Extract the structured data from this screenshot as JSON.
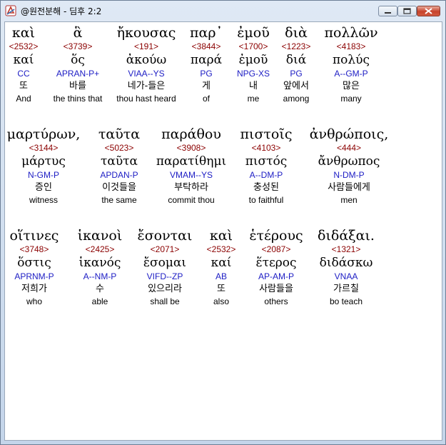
{
  "window": {
    "title": "@원전분해 - 딤후 2:2"
  },
  "rows": [
    {
      "words": [
        {
          "greek": "καὶ",
          "strong": "<2532>",
          "lemma": "καί",
          "morph": "CC",
          "korean": "또",
          "english": "And"
        },
        {
          "greek": "ἃ",
          "strong": "<3739>",
          "lemma": "ὅς",
          "morph": "APRAN-P+",
          "korean": "바를",
          "english": "the thins that"
        },
        {
          "greek": "ἤκουσας",
          "strong": "<191>",
          "lemma": "ἀκούω",
          "morph": "VIAA--YS",
          "korean": "네가-들은",
          "english": "thou hast heard"
        },
        {
          "greek": "παρ᾽",
          "strong": "<3844>",
          "lemma": "παρά",
          "morph": "PG",
          "korean": "게",
          "english": "of"
        },
        {
          "greek": "ἐμοῦ",
          "strong": "<1700>",
          "lemma": "ἐμοῦ",
          "morph": "NPG-XS",
          "korean": "내",
          "english": "me"
        },
        {
          "greek": "διὰ",
          "strong": "<1223>",
          "lemma": "διά",
          "morph": "PG",
          "korean": "앞에서",
          "english": "among"
        },
        {
          "greek": "πολλῶν",
          "strong": "<4183>",
          "lemma": "πολύς",
          "morph": "A--GM-P",
          "korean": "많은",
          "english": "many"
        }
      ]
    },
    {
      "words": [
        {
          "greek": "μαρτύρων,",
          "strong": "<3144>",
          "lemma": "μάρτυς",
          "morph": "N-GM-P",
          "korean": "증인",
          "english": "witness"
        },
        {
          "greek": "ταῦτα",
          "strong": "<5023>",
          "lemma": "ταῦτα",
          "morph": "APDAN-P",
          "korean": "이것들을",
          "english": "the same"
        },
        {
          "greek": "παράθου",
          "strong": "<3908>",
          "lemma": "παρατίθημι",
          "morph": "VMAM--YS",
          "korean": "부탁하라",
          "english": "commit thou"
        },
        {
          "greek": "πιστοῖς",
          "strong": "<4103>",
          "lemma": "πιστός",
          "morph": "A--DM-P",
          "korean": "충성된",
          "english": "to faithful"
        },
        {
          "greek": "ἀνθρώποις,",
          "strong": "<444>",
          "lemma": "ἄνθρωπος",
          "morph": "N-DM-P",
          "korean": "사람들에게",
          "english": "men"
        }
      ]
    },
    {
      "words": [
        {
          "greek": "οἵτινες",
          "strong": "<3748>",
          "lemma": "ὅστις",
          "morph": "APRNM-P",
          "korean": "저희가",
          "english": "who"
        },
        {
          "greek": "ἱκανοὶ",
          "strong": "<2425>",
          "lemma": "ἱκανός",
          "morph": "A--NM-P",
          "korean": "수",
          "english": "able"
        },
        {
          "greek": "ἔσονται",
          "strong": "<2071>",
          "lemma": "ἔσομαι",
          "morph": "VIFD--ZP",
          "korean": "있으리라",
          "english": "shall be"
        },
        {
          "greek": "καὶ",
          "strong": "<2532>",
          "lemma": "καί",
          "morph": "AB",
          "korean": "또",
          "english": "also"
        },
        {
          "greek": "ἑτέρους",
          "strong": "<2087>",
          "lemma": "ἕτερος",
          "morph": "AP-AM-P",
          "korean": "사람들을",
          "english": "others"
        },
        {
          "greek": "διδάξαι.",
          "strong": "<1321>",
          "lemma": "διδάσκω",
          "morph": "VNAA",
          "korean": "가르칠",
          "english": "bo teach"
        }
      ]
    }
  ]
}
